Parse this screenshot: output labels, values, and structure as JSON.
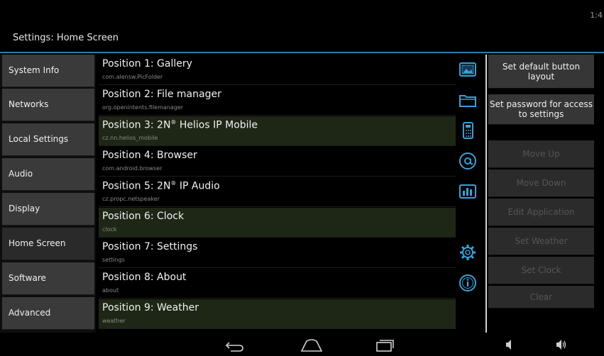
{
  "status": {
    "clock": "1:4"
  },
  "header": {
    "title": "Settings: Home Screen"
  },
  "sidebar": {
    "items": [
      {
        "label": "System Info"
      },
      {
        "label": "Networks"
      },
      {
        "label": "Local Settings"
      },
      {
        "label": "Audio"
      },
      {
        "label": "Display"
      },
      {
        "label": "Home Screen"
      },
      {
        "label": "Software"
      },
      {
        "label": "Advanced"
      }
    ]
  },
  "positions": [
    {
      "title": "Position 1: Gallery",
      "package": "com.alensw.PicFolder",
      "icon": "gallery-icon"
    },
    {
      "title": "Position 2: File manager",
      "package": "org.openintents.filemanager",
      "icon": "folder-icon"
    },
    {
      "title_main": "Position 3: 2N",
      "title_sup": "®",
      "title_rest": " Helios IP Mobile",
      "package": "cz.nn.helios_mobile",
      "icon": "intercom-icon"
    },
    {
      "title": "Position 4: Browser",
      "package": "com.android.browser",
      "icon": "browser-icon"
    },
    {
      "title_main": "Position 5: 2N",
      "title_sup": "®",
      "title_rest": " IP Audio",
      "package": "cz.propc.netspeaker",
      "icon": "audio-icon"
    },
    {
      "title": "Position 6: Clock",
      "package": "clock",
      "icon": ""
    },
    {
      "title": "Position 7: Settings",
      "package": "settings",
      "icon": "gear-icon"
    },
    {
      "title": "Position 8: About",
      "package": "about",
      "icon": "info-icon"
    },
    {
      "title": "Position 9: Weather",
      "package": "weather",
      "icon": ""
    }
  ],
  "actions": {
    "set_default_layout": "Set default button layout",
    "set_password": "Set password for access to settings",
    "move_up": "Move Up",
    "move_down": "Move Down",
    "edit_application": "Edit Application",
    "set_weather": "Set Weather",
    "set_clock": "Set Clock",
    "clear": "Clear"
  },
  "colors": {
    "accent": "#2e7fa3",
    "highlight_row": "#1e2716",
    "icon_blue": "#3aa0d8"
  }
}
